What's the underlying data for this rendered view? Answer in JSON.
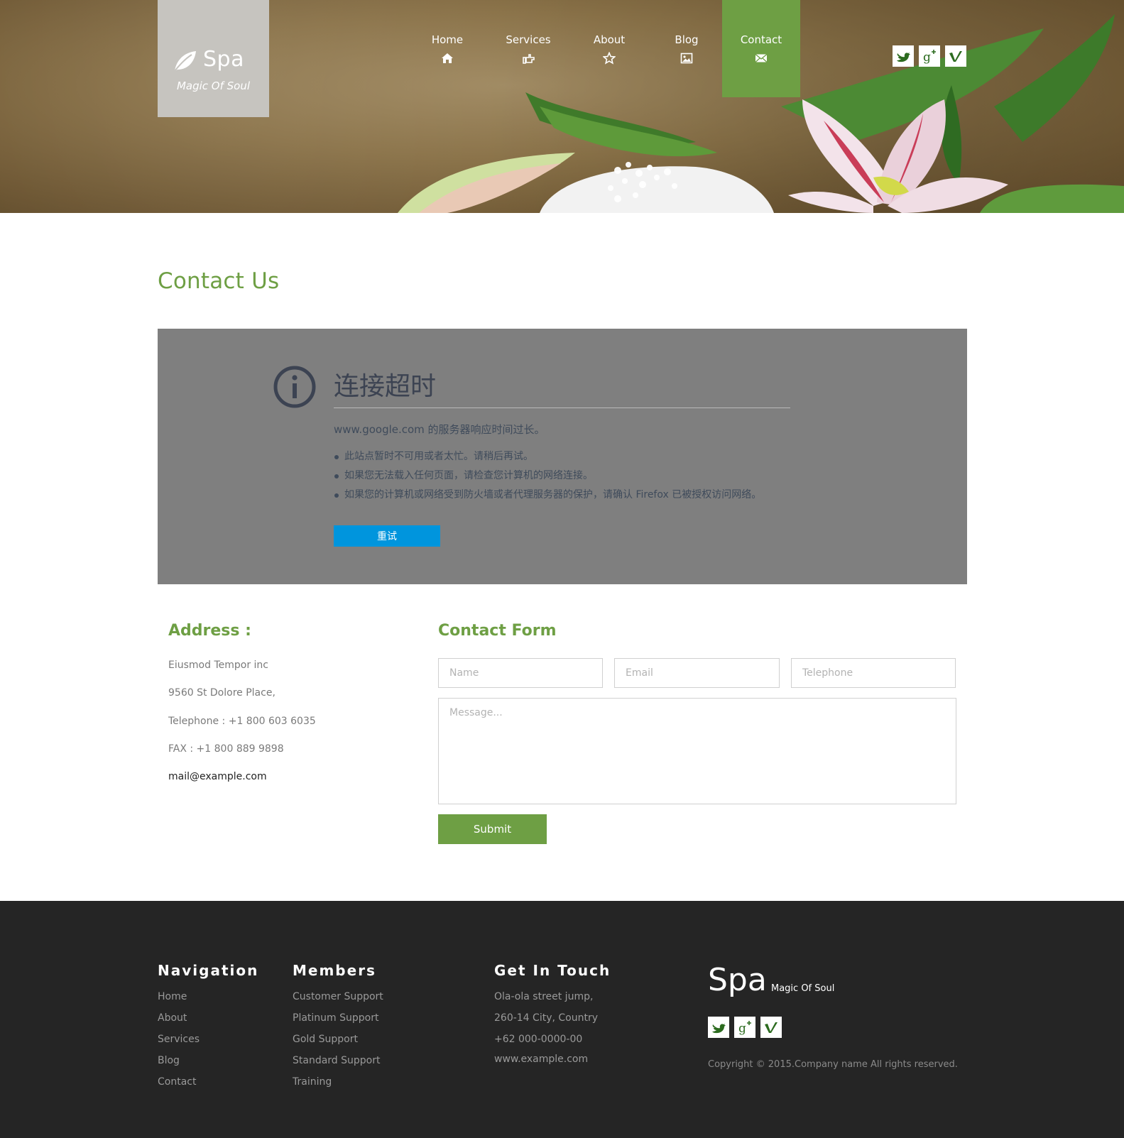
{
  "header": {
    "logo_name": "Spa",
    "logo_tagline": "Magic Of Soul",
    "nav": [
      {
        "label": "Home",
        "icon": "home-icon",
        "active": false
      },
      {
        "label": "Services",
        "icon": "hand-point-icon",
        "active": false
      },
      {
        "label": "About",
        "icon": "star-icon",
        "active": false
      },
      {
        "label": "Blog",
        "icon": "picture-icon",
        "active": false
      },
      {
        "label": "Contact",
        "icon": "envelope-icon",
        "active": true
      }
    ],
    "social": [
      "twitter-icon",
      "google-plus-icon",
      "vimeo-icon"
    ]
  },
  "page_title": "Contact Us",
  "map_error": {
    "title": "连接超时",
    "description": "www.google.com 的服务器响应时间过长。",
    "bullets": [
      "此站点暂时不可用或者太忙。请稍后再试。",
      "如果您无法载入任何页面，请检查您计算机的网络连接。",
      "如果您的计算机或网络受到防火墙或者代理服务器的保护，请确认 Firefox 已被授权访问网络。"
    ],
    "retry_label": "重试"
  },
  "address": {
    "heading": "Address :",
    "lines": [
      "Eiusmod Tempor inc",
      "9560 St Dolore Place,",
      "Telephone : +1 800 603 6035",
      "FAX : +1 800 889 9898"
    ],
    "email": "mail@example.com"
  },
  "contact_form": {
    "heading": "Contact Form",
    "name_placeholder": "Name",
    "email_placeholder": "Email",
    "telephone_placeholder": "Telephone",
    "message_placeholder": "Message...",
    "submit_label": "Submit"
  },
  "footer": {
    "navigation": {
      "heading": "Navigation",
      "links": [
        "Home",
        "About",
        "Services",
        "Blog",
        "Contact"
      ]
    },
    "members": {
      "heading": "Members",
      "links": [
        "Customer Support",
        "Platinum Support",
        "Gold Support",
        "Standard Support",
        "Training"
      ]
    },
    "get_in_touch": {
      "heading": "Get In Touch",
      "lines": [
        "Ola-ola street jump,",
        "260-14 City, Country",
        "+62 000-0000-00",
        "www.example.com"
      ]
    },
    "brand_name": "Spa",
    "brand_tagline": "Magic Of Soul",
    "copyright": "Copyright © 2015.Company name All rights reserved."
  },
  "colors": {
    "accent_green": "#6e9f44",
    "retry_blue": "#0095dd",
    "footer_bg": "#252525",
    "panel_gray": "#7f7f7f"
  }
}
